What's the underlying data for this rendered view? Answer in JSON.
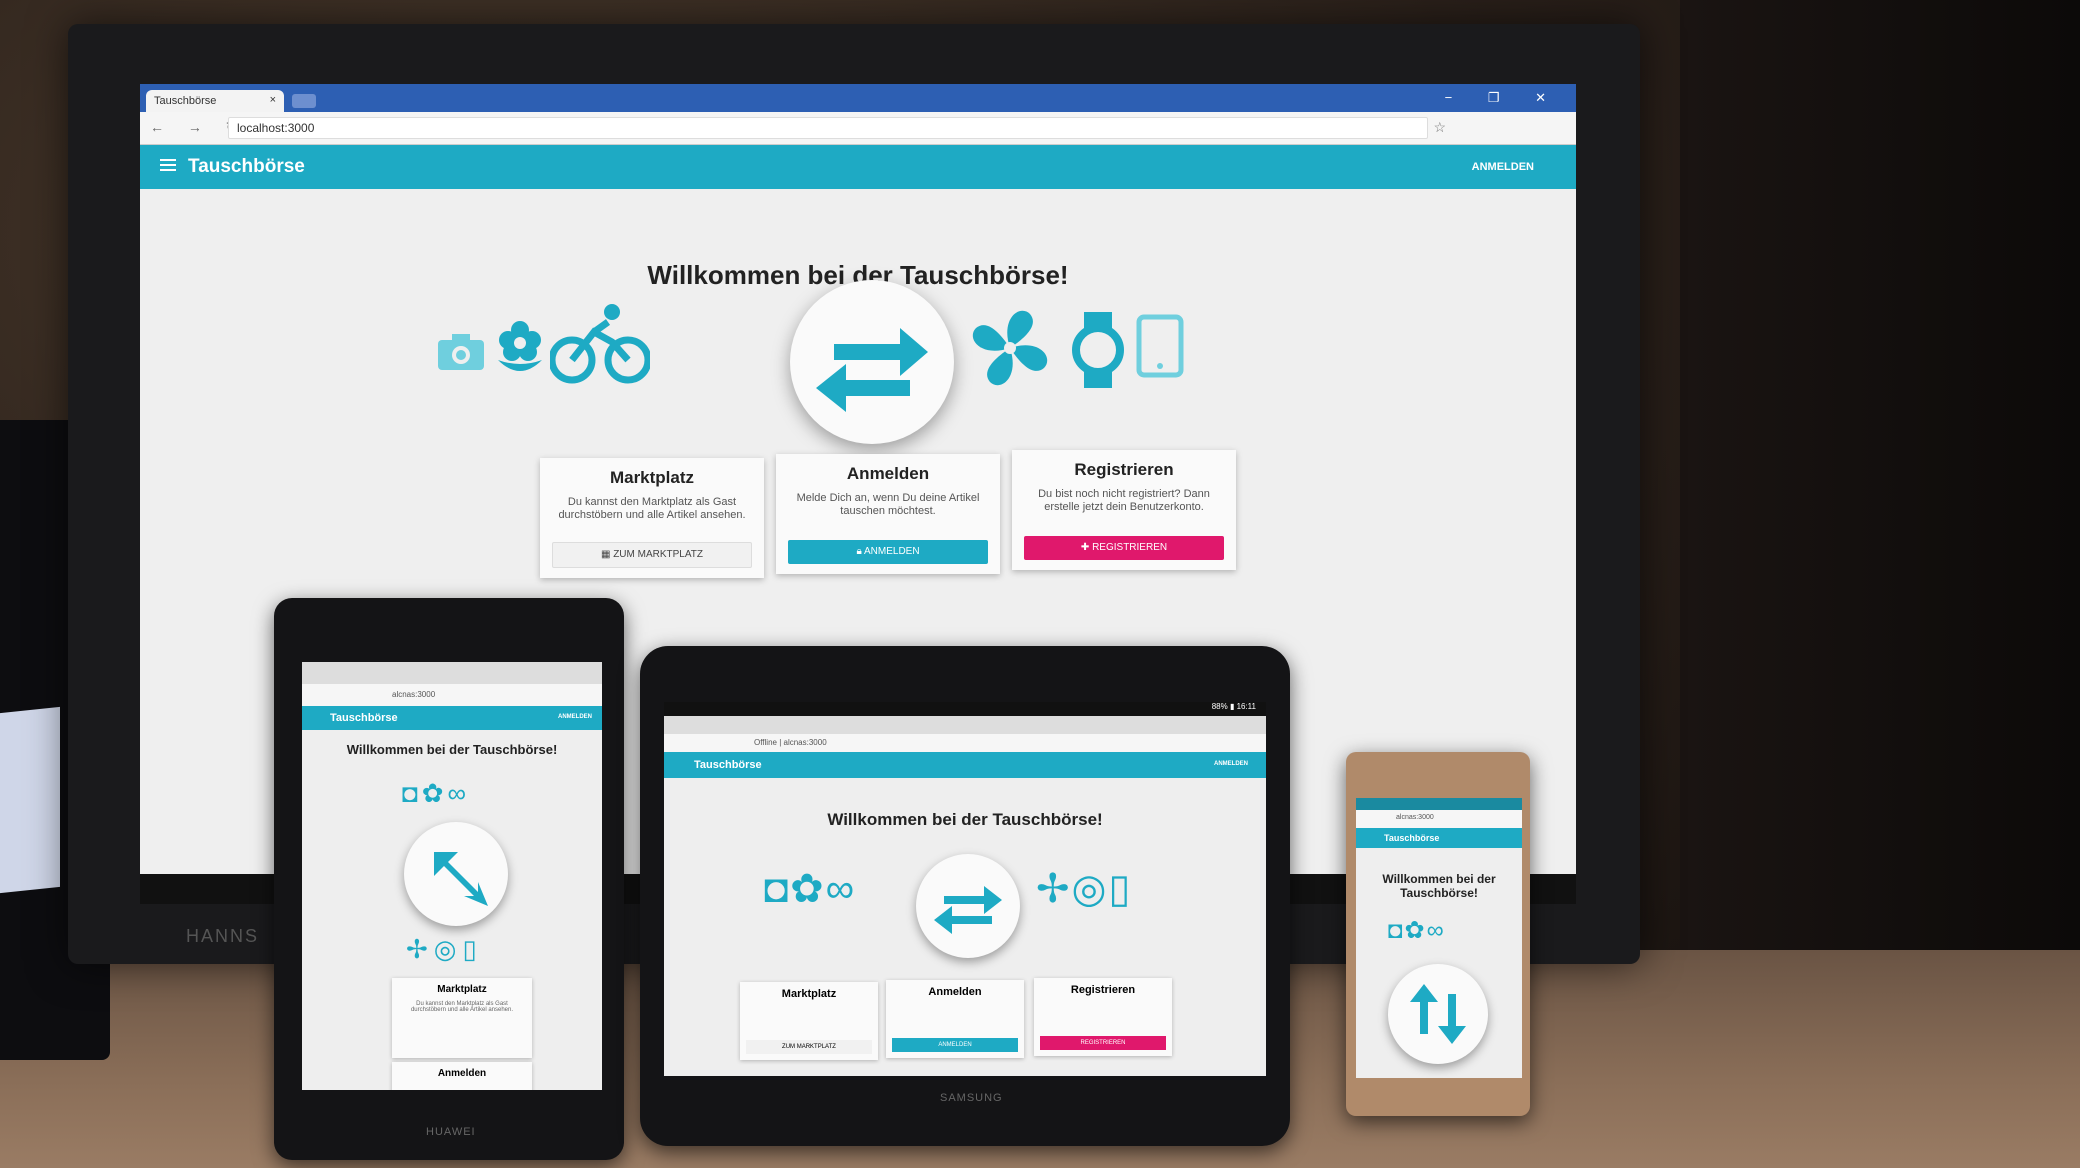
{
  "browser": {
    "tab_label": "Tauschbörse",
    "tab_close": "×",
    "url": "localhost:3000",
    "window_controls": "− ❐ ✕",
    "nav_glyphs": "← → ↻ ⌂",
    "star_glyph": "☆"
  },
  "app": {
    "title": "Tauschbörse",
    "login_label": "ANMELDEN",
    "welcome": "Willkommen bei der Tauschbörse!",
    "accent_color": "#1eaac4",
    "pink_color": "#e0186c",
    "hero_icons": [
      "camera-icon",
      "flower-icon",
      "bicycle-icon",
      "swap-arrows-icon",
      "fan-icon",
      "watch-icon",
      "tablet-icon"
    ]
  },
  "cards": [
    {
      "title": "Marktplatz",
      "text": "Du kannst den Marktplatz als Gast durchstöbern und alle Artikel ansehen.",
      "button": "ZUM MARKTPLATZ",
      "icon": "building-icon"
    },
    {
      "title": "Anmelden",
      "text": "Melde Dich an, wenn Du deine Artikel tauschen möchtest.",
      "button": "ANMELDEN",
      "icon": "lock-icon"
    },
    {
      "title": "Registrieren",
      "text": "Du bist noch nicht registriert? Dann erstelle jetzt dein Benutzerkonto.",
      "button": "REGISTRIEREN",
      "icon": "add-person-icon"
    }
  ],
  "devices": {
    "monitor_brand": "HANNS",
    "tablet_small": {
      "brand": "HUAWEI",
      "url": "alcnas:3000",
      "welcome": "Willkommen bei der Tauschbörse!",
      "card1": "Marktplatz",
      "card2": "Anmelden"
    },
    "tablet_large": {
      "brand": "SAMSUNG",
      "url": "Offline | alcnas:3000",
      "status": "88% ▮ 16:11",
      "welcome": "Willkommen bei der Tauschbörse!",
      "cards": [
        "Marktplatz",
        "Anmelden",
        "Registrieren"
      ],
      "buttons": [
        "ZUM MARKTPLATZ",
        "ANMELDEN",
        "REGISTRIEREN"
      ]
    },
    "phone": {
      "url": "alcnas:3000",
      "welcome": "Willkommen bei der Tauschbörse!"
    }
  }
}
